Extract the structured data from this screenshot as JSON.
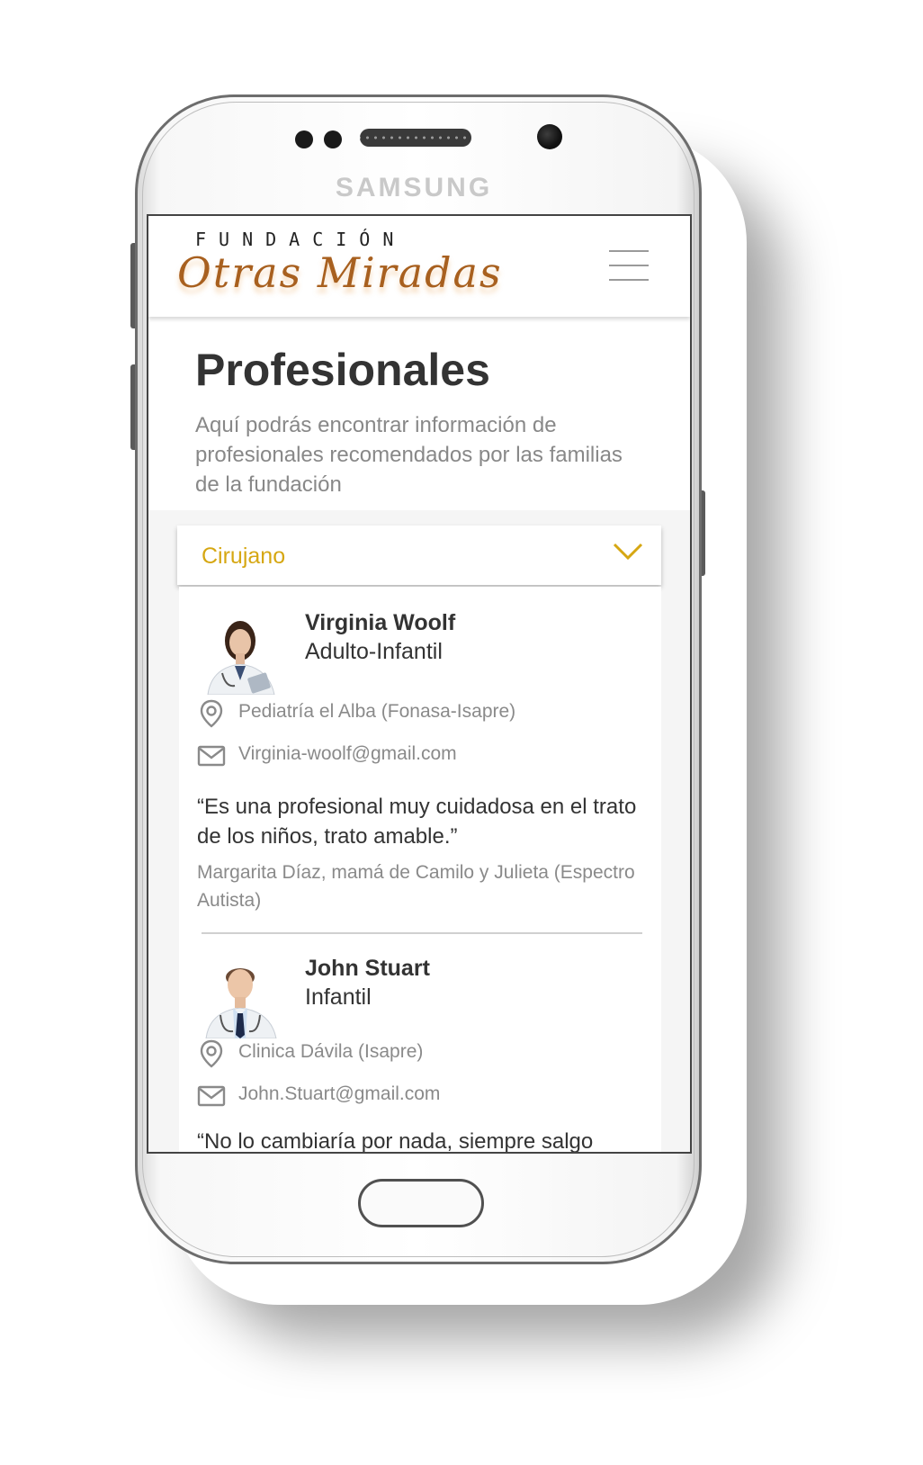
{
  "device": {
    "brand": "SAMSUNG"
  },
  "header": {
    "logo_top": "FUNDACIÓN",
    "logo_main": "Otras Miradas",
    "menu_icon": "hamburger-menu-icon"
  },
  "page": {
    "title": "Profesionales",
    "subtitle": "Aquí podrás encontrar información de profesionales recomendados por las familias de la fundación"
  },
  "filter": {
    "selected": "Cirujano",
    "icon": "chevron-down-icon",
    "accent_color": "#d6a712"
  },
  "professionals": [
    {
      "name": "Virginia Woolf",
      "specialty": "Adulto-Infantil",
      "location": "Pediatría el Alba (Fonasa-Isapre)",
      "email": "Virginia-woolf@gmail.com",
      "quote": "“Es una profesional muy cuidadosa en el trato de los niños, trato amable.”",
      "author": "Margarita Díaz, mamá de Camilo y Julieta (Espectro Autista)"
    },
    {
      "name": "John Stuart",
      "specialty": "Infantil",
      "location": "Clinica Dávila (Isapre)",
      "email": "John.Stuart@gmail.com",
      "quote": "“No lo cambiaría por nada, siempre salgo"
    }
  ]
}
